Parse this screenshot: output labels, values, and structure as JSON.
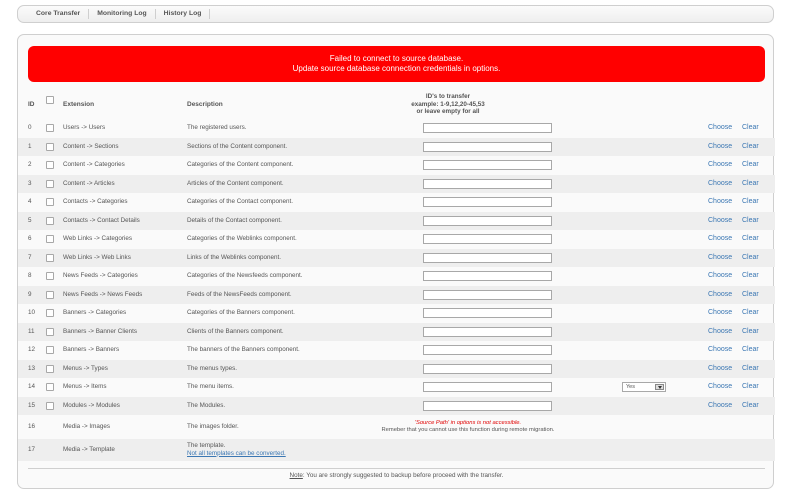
{
  "nav": {
    "tabs": [
      "Core Transfer",
      "Monitoring Log",
      "History Log"
    ]
  },
  "error": {
    "line1": "Failed to connect to source database.",
    "line2": "Update source database connection credentials in options."
  },
  "table": {
    "headers": {
      "id": "ID",
      "extension": "Extension",
      "description": "Description",
      "ids_line1": "ID's to transfer",
      "ids_line2": "example: 1-9,12,20-45,53",
      "ids_line3": "or leave empty for all"
    },
    "rows": [
      {
        "id": "0",
        "extension": "Users -> Users",
        "description": "The registered users."
      },
      {
        "id": "1",
        "extension": "Content -> Sections",
        "description": "Sections of the Content component."
      },
      {
        "id": "2",
        "extension": "Content -> Categories",
        "description": "Categories of the Content component."
      },
      {
        "id": "3",
        "extension": "Content -> Articles",
        "description": "Articles of the Content component."
      },
      {
        "id": "4",
        "extension": "Contacts -> Categories",
        "description": "Categories of the Contact component."
      },
      {
        "id": "5",
        "extension": "Contacts -> Contact Details",
        "description": "Details of the Contact component."
      },
      {
        "id": "6",
        "extension": "Web Links -> Categories",
        "description": "Categories of the Weblinks component."
      },
      {
        "id": "7",
        "extension": "Web Links -> Web Links",
        "description": "Links of the Weblinks component."
      },
      {
        "id": "8",
        "extension": "News Feeds -> Categories",
        "description": "Categories of the Newsfeeds component."
      },
      {
        "id": "9",
        "extension": "News Feeds -> News Feeds",
        "description": "Feeds of the NewsFeeds component."
      },
      {
        "id": "10",
        "extension": "Banners -> Categories",
        "description": "Categories of the Banners component."
      },
      {
        "id": "11",
        "extension": "Banners -> Banner Clients",
        "description": "Clients of the Banners component."
      },
      {
        "id": "12",
        "extension": "Banners -> Banners",
        "description": "The banners of the Banners component."
      },
      {
        "id": "13",
        "extension": "Menus -> Types",
        "description": "The menus types."
      },
      {
        "id": "14",
        "extension": "Menus -> Items",
        "description": "The menu items.",
        "select": "Yes"
      },
      {
        "id": "15",
        "extension": "Modules -> Modules",
        "description": "The Modules."
      }
    ],
    "choose_label": "Choose",
    "clear_label": "Clear",
    "media_images": {
      "id": "16",
      "extension": "Media -> Images",
      "description": "The images folder.",
      "note_red": "'Source Path' in options is not accessible.",
      "note": "Remeber that you cannot use this function during remote migration."
    },
    "media_template": {
      "id": "17",
      "extension": "Media -> Template",
      "description": "The template.",
      "link": "Not all templates can be converted."
    }
  },
  "footer": {
    "note_label": "Note",
    "text": ": You are strongly suggested to backup before proceed with the transfer."
  }
}
